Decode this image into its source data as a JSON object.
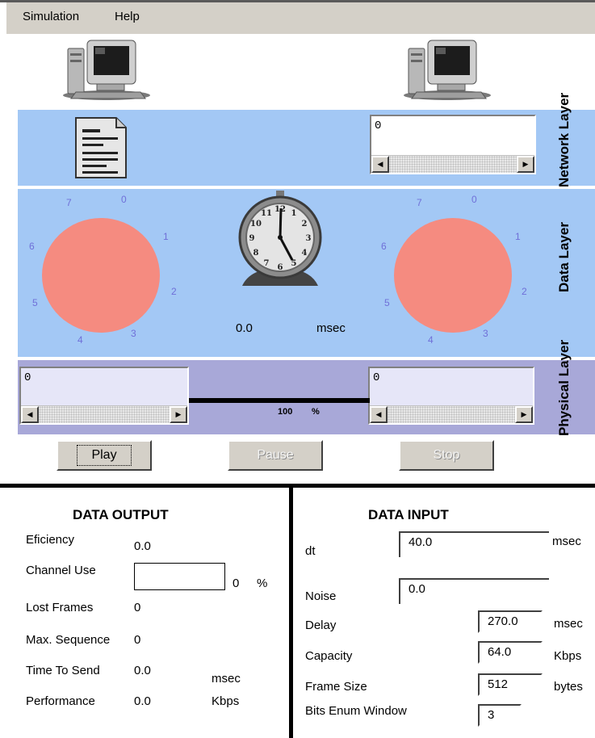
{
  "menu": {
    "simulation": "Simulation",
    "help": "Help"
  },
  "layers": {
    "network": "Network Layer",
    "data": "Data Layer",
    "physical": "Physical Layer"
  },
  "network": {
    "receiver_text": "0"
  },
  "dial_labels": [
    "0",
    "1",
    "2",
    "3",
    "4",
    "5",
    "6",
    "7"
  ],
  "timer": {
    "value": "0.0",
    "unit": "msec"
  },
  "physical": {
    "left_text": "0",
    "right_text": "0",
    "channel_percent": "100",
    "percent_sign": "%"
  },
  "controls": {
    "play": "Play",
    "pause": "Pause",
    "stop": "Stop"
  },
  "output": {
    "title": "DATA OUTPUT",
    "efficiency_label": "Eficiency",
    "efficiency": "0.0",
    "channel_use_label": "Channel Use",
    "channel_use": "0",
    "channel_use_unit": "%",
    "lost_frames_label": "Lost Frames",
    "lost_frames": "0",
    "max_sequence_label": "Max. Sequence",
    "max_sequence": "0",
    "time_to_send_label": "Time To Send",
    "time_to_send": "0.0",
    "time_to_send_unit": "msec",
    "performance_label": "Performance",
    "performance": "0.0",
    "performance_unit": "Kbps"
  },
  "input": {
    "title": "DATA INPUT",
    "dt_label": "dt",
    "dt": "40.0",
    "dt_unit": "msec",
    "noise_label": "Noise",
    "noise": "0.0",
    "delay_label": "Delay",
    "delay": "270.0",
    "delay_unit": "msec",
    "capacity_label": "Capacity",
    "capacity": "64.0",
    "capacity_unit": "Kbps",
    "frame_size_label": "Frame Size",
    "frame_size": "512",
    "frame_size_unit": "bytes",
    "bits_label": "Bits Enum Window",
    "bits": "3"
  },
  "colors": {
    "band_blue": "#a3c8f5",
    "band_lavender": "#a8a8d8",
    "window_circle": "#f58b80",
    "dial_digits": "#6f6fd8"
  }
}
